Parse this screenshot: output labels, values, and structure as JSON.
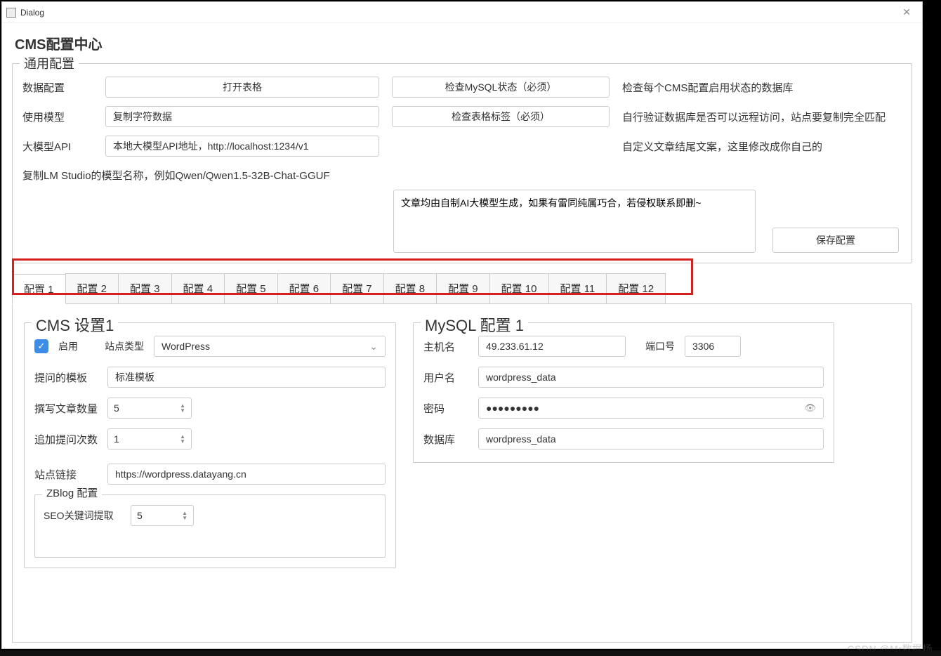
{
  "window": {
    "title": "Dialog"
  },
  "app_title": "CMS配置中心",
  "general": {
    "legend": "通用配置",
    "row_data": {
      "label": "数据配置",
      "btn_open_table": "打开表格",
      "btn_check_mysql": "检查MySQL状态（必须）",
      "helper": "检查每个CMS配置启用状态的数据库"
    },
    "row_model": {
      "label": "使用模型",
      "input_value": "复制字符数据",
      "btn_check_tags": "检查表格标签（必须）",
      "helper": "自行验证数据库是否可以远程访问，站点要复制完全匹配"
    },
    "row_api": {
      "label": "大模型API",
      "input_value": "本地大模型API地址，http://localhost:1234/v1",
      "helper": "自定义文章结尾文案，这里修改成你自己的"
    },
    "copy_hint": "复制LM Studio的模型名称，例如Qwen/Qwen1.5-32B-Chat-GGUF",
    "footer_text": "文章均由自制AI大模型生成，如果有雷同纯属巧合，若侵权联系即删~",
    "save_btn": "保存配置"
  },
  "tabs": [
    "配置 1",
    "配置 2",
    "配置 3",
    "配置 4",
    "配置 5",
    "配置 6",
    "配置 7",
    "配置 8",
    "配置 9",
    "配置 10",
    "配置 11",
    "配置 12"
  ],
  "cms": {
    "legend": "CMS 设置1",
    "enable_label": "启用",
    "site_type_label": "站点类型",
    "site_type_value": "WordPress",
    "template_label": "提问的模板",
    "template_value": "标准模板",
    "article_count_label": "撰写文章数量",
    "article_count_value": "5",
    "followup_label": "追加提问次数",
    "followup_value": "1",
    "site_link_label": "站点链接",
    "site_link_value": "https://wordpress.datayang.cn",
    "zblog": {
      "legend": "ZBlog 配置",
      "seo_label": "SEO关键词提取",
      "seo_value": "5"
    }
  },
  "mysql": {
    "legend": "MySQL 配置 1",
    "host_label": "主机名",
    "host_value": "49.233.61.12",
    "port_label": "端口号",
    "port_value": "3306",
    "user_label": "用户名",
    "user_value": "wordpress_data",
    "password_label": "密码",
    "password_value": "●●●●●●●●●",
    "db_label": "数据库",
    "db_value": "wordpress_data"
  },
  "watermark": "CSDN @Mr数据杨"
}
